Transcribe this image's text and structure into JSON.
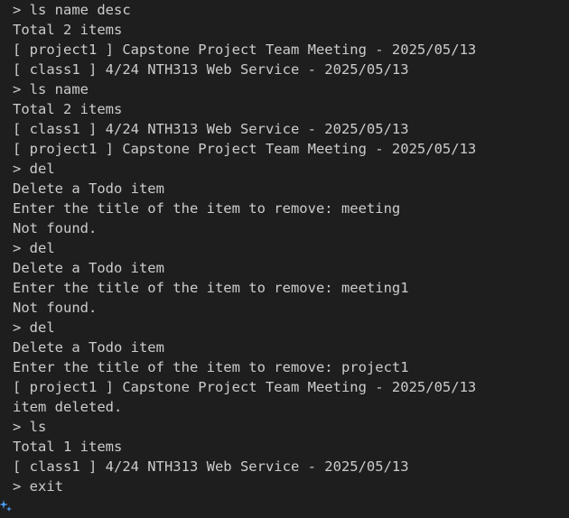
{
  "terminal": {
    "lines": [
      "> ls name desc",
      "Total 2 items",
      "[ project1 ] Capstone Project Team Meeting - 2025/05/13",
      "[ class1 ] 4/24 NTH313 Web Service - 2025/05/13",
      "> ls name",
      "Total 2 items",
      "[ class1 ] 4/24 NTH313 Web Service - 2025/05/13",
      "[ project1 ] Capstone Project Team Meeting - 2025/05/13",
      "> del",
      "Delete a Todo item",
      "Enter the title of the item to remove: meeting",
      "Not found.",
      "> del",
      "Delete a Todo item",
      "Enter the title of the item to remove: meeting1",
      "Not found.",
      "> del",
      "Delete a Todo item",
      "Enter the title of the item to remove: project1",
      "[ project1 ] Capstone Project Team Meeting - 2025/05/13",
      "item deleted.",
      "> ls",
      "Total 1 items",
      "[ class1 ] 4/24 NTH313 Web Service - 2025/05/13",
      "> exit"
    ],
    "cursor_icon": "sparkle-icon",
    "colors": {
      "background": "#1e1e1e",
      "foreground": "#cccccc",
      "icon": "#4da3ff"
    }
  }
}
